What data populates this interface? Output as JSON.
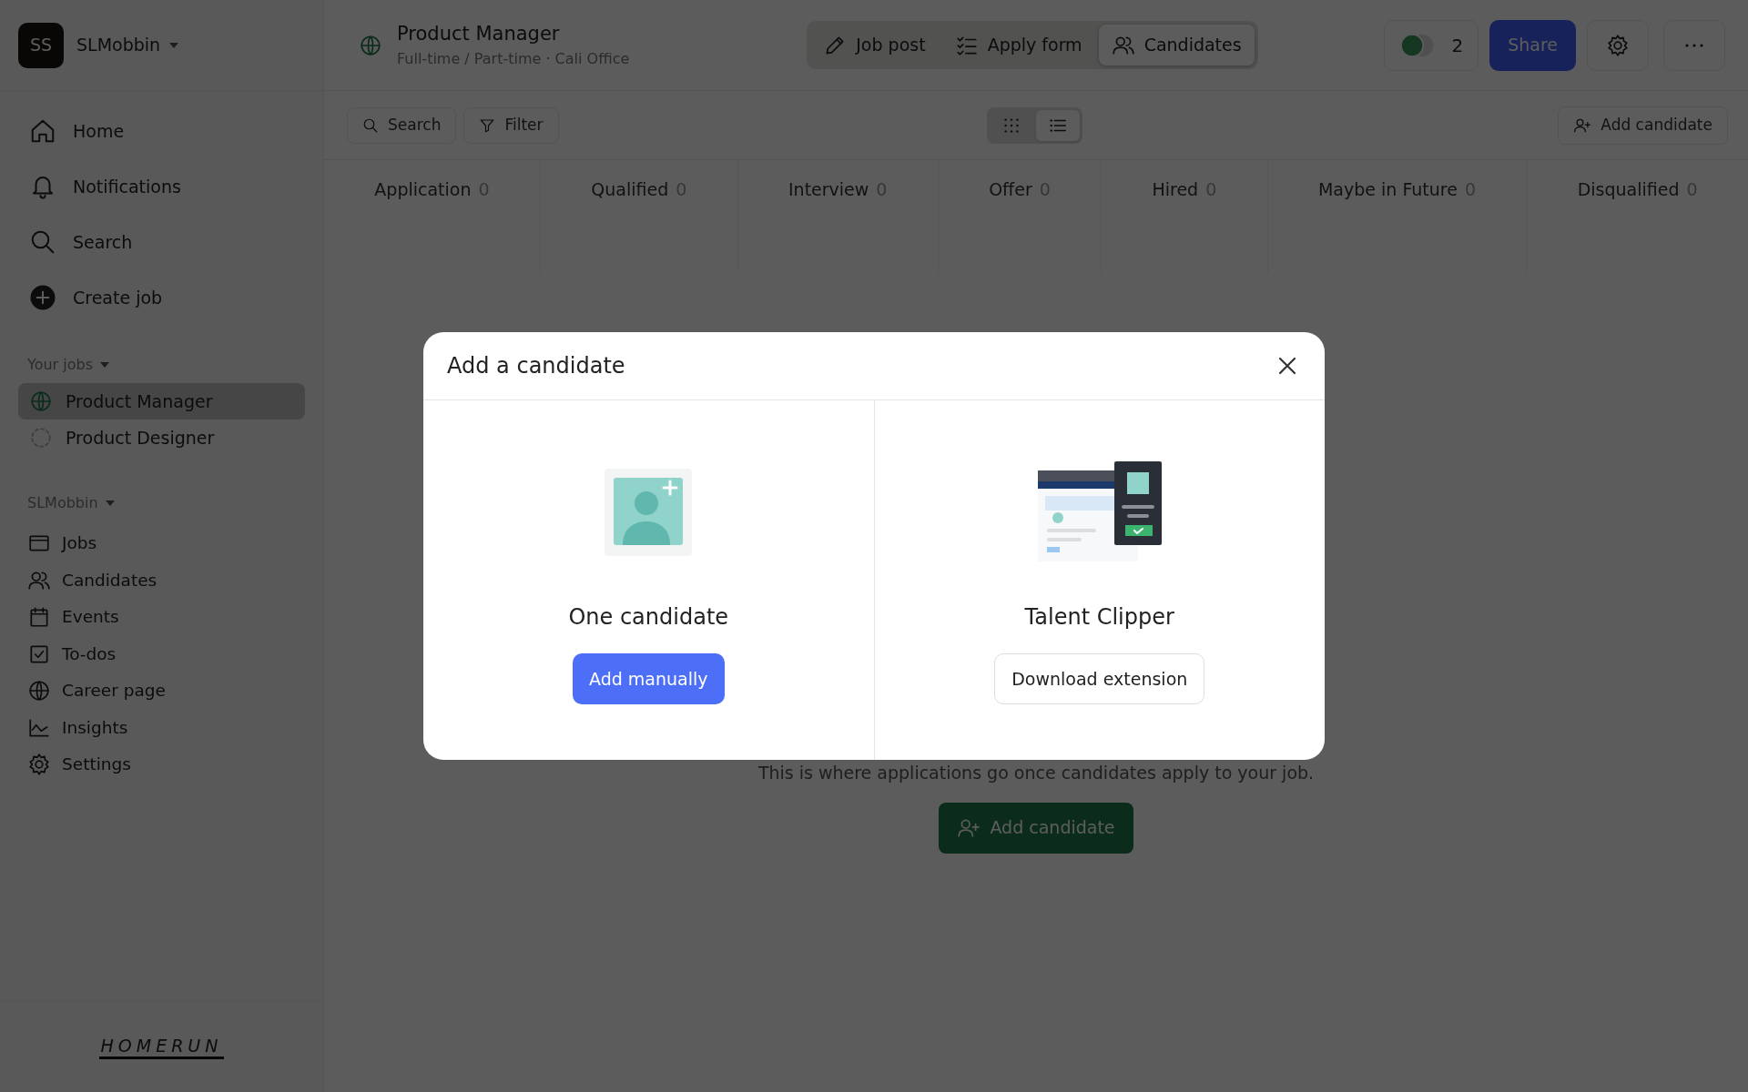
{
  "workspace": {
    "initials": "SS",
    "name": "SLMobbin"
  },
  "main_nav": [
    {
      "label": "Home"
    },
    {
      "label": "Notifications"
    },
    {
      "label": "Search"
    },
    {
      "label": "Create job"
    }
  ],
  "your_jobs": {
    "heading": "Your jobs",
    "items": [
      {
        "label": "Product Manager",
        "selected": true,
        "kind": "published"
      },
      {
        "label": "Product Designer",
        "selected": false,
        "kind": "draft"
      }
    ]
  },
  "workspace_nav": {
    "heading": "SLMobbin",
    "items": [
      {
        "label": "Jobs"
      },
      {
        "label": "Candidates"
      },
      {
        "label": "Events"
      },
      {
        "label": "To-dos"
      },
      {
        "label": "Career page"
      },
      {
        "label": "Insights"
      },
      {
        "label": "Settings"
      }
    ]
  },
  "brand": "HOMERUN",
  "job": {
    "title": "Product Manager",
    "subtitle": "Full-time / Part-time · Cali Office"
  },
  "tabs": [
    {
      "label": "Job post",
      "selected": false
    },
    {
      "label": "Apply form",
      "selected": false
    },
    {
      "label": "Candidates",
      "selected": true
    }
  ],
  "collaborators": {
    "count": "2"
  },
  "share": "Share",
  "toolbar": {
    "search": "Search",
    "filter": "Filter",
    "views": [
      {
        "kind": "grid",
        "selected": false
      },
      {
        "kind": "list",
        "selected": true
      }
    ],
    "add": "Add candidate"
  },
  "stages": [
    {
      "name": "Application",
      "count": "0"
    },
    {
      "name": "Qualified",
      "count": "0"
    },
    {
      "name": "Interview",
      "count": "0"
    },
    {
      "name": "Offer",
      "count": "0"
    },
    {
      "name": "Hired",
      "count": "0"
    },
    {
      "name": "Maybe in Future",
      "count": "0"
    },
    {
      "name": "Disqualified",
      "count": "0"
    }
  ],
  "empty_state": {
    "text": "This is where applications go once candidates apply to your job.",
    "button": "Add candidate"
  },
  "modal": {
    "title": "Add a candidate",
    "options": [
      {
        "kind": "manual",
        "title": "One candidate",
        "button": "Add manually",
        "primary": true
      },
      {
        "kind": "clipper",
        "title": "Talent Clipper",
        "button": "Download extension",
        "primary": false
      }
    ]
  }
}
